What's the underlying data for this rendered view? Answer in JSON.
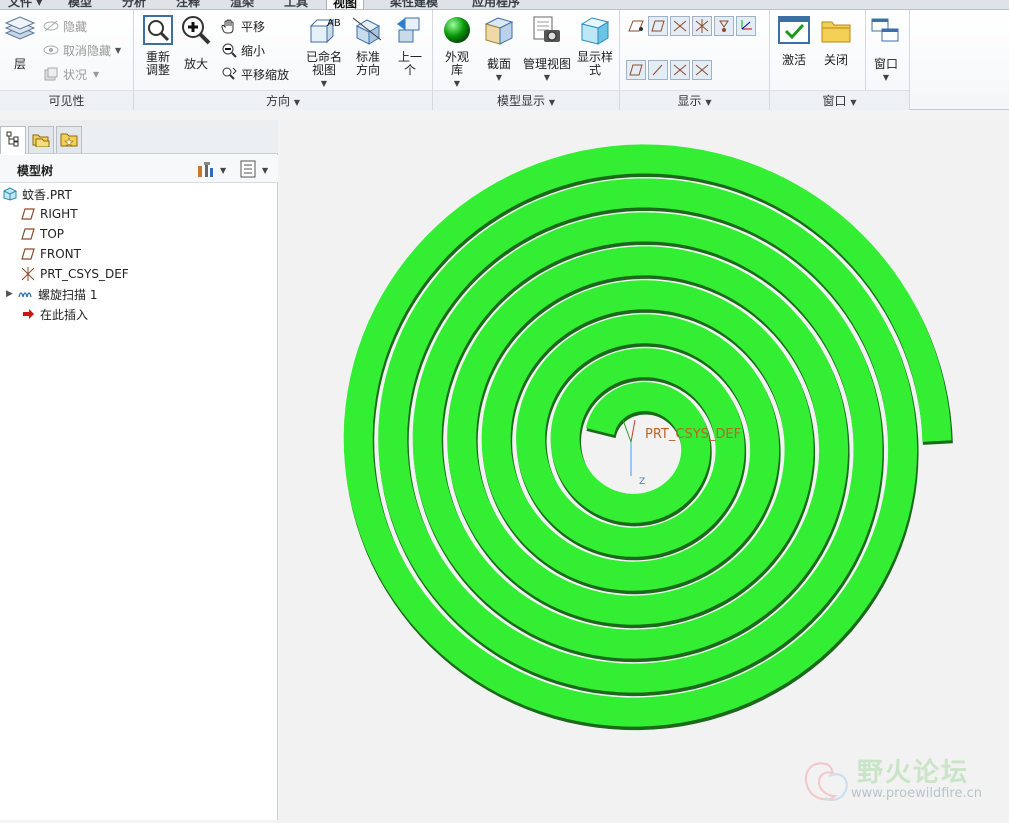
{
  "tabs": [
    {
      "label": "文件"
    },
    {
      "label": "模型"
    },
    {
      "label": "分析"
    },
    {
      "label": "注释"
    },
    {
      "label": "渲染"
    },
    {
      "label": "工具"
    },
    {
      "label": "视图"
    },
    {
      "label": "柔性建模"
    },
    {
      "label": "应用程序"
    }
  ],
  "ribbon": {
    "visibility": {
      "label": "可见性",
      "layer": "层",
      "hide": "隐藏",
      "unhide": "取消隐藏",
      "status": "状况"
    },
    "orientation": {
      "label": "方向",
      "refit": "重新调整",
      "zoom_in": "放大",
      "pan": "平移",
      "zoom_out": "缩小",
      "pan_zoom": "平移缩放",
      "named_views": "已命名视图",
      "standard_orientation": "标准方向",
      "previous": "上一个"
    },
    "model_display": {
      "label": "模型显示",
      "appearance": "外观库",
      "section": "截面",
      "manage_views": "管理视图",
      "display_style": "显示样式"
    },
    "show": {
      "label": "显示"
    },
    "window": {
      "label": "窗口",
      "activate": "激活",
      "close": "关闭",
      "windows": "窗口"
    }
  },
  "model_tree": {
    "title": "模型树",
    "items": [
      {
        "label": "蚊香.PRT",
        "icon": "part-icon"
      },
      {
        "label": "RIGHT",
        "icon": "datum-plane-icon"
      },
      {
        "label": "TOP",
        "icon": "datum-plane-icon"
      },
      {
        "label": "FRONT",
        "icon": "datum-plane-icon"
      },
      {
        "label": "PRT_CSYS_DEF",
        "icon": "csys-icon"
      },
      {
        "label": "螺旋扫描 1",
        "icon": "helical-sweep-icon"
      },
      {
        "label": "在此插入",
        "icon": "insert-here-arrow-icon"
      }
    ]
  },
  "graphics": {
    "csys_label": "PRT_CSYS_DEF",
    "axis_z": "Z",
    "model_color": "#33ee33",
    "background_color": "#f2f2f2"
  },
  "watermark": {
    "text": "野火论坛",
    "url": "www.proewildfire.cn"
  }
}
